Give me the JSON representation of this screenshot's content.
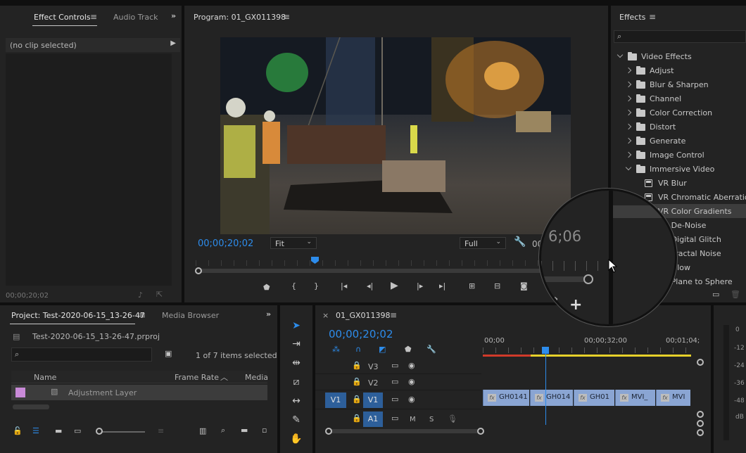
{
  "source_panel": {
    "tabs": [
      "Effect Controls",
      "Audio Track"
    ],
    "no_clip": "(no clip selected)",
    "timecode": "00;00;20;02"
  },
  "program": {
    "title": "Program: 01_GX011398",
    "timecode": "00;00;20;02",
    "fit": "Fit",
    "quality": "Full",
    "duration_partial": "00;00;",
    "magnified_time": "6;06"
  },
  "effects": {
    "title": "Effects",
    "search_placeholder": "",
    "tree": [
      {
        "label": "Video Effects",
        "type": "folder",
        "level": 0,
        "open": true
      },
      {
        "label": "Adjust",
        "type": "folder",
        "level": 1
      },
      {
        "label": "Blur & Sharpen",
        "type": "folder",
        "level": 1
      },
      {
        "label": "Channel",
        "type": "folder",
        "level": 1
      },
      {
        "label": "Color Correction",
        "type": "folder",
        "level": 1
      },
      {
        "label": "Distort",
        "type": "folder",
        "level": 1
      },
      {
        "label": "Generate",
        "type": "folder",
        "level": 1
      },
      {
        "label": "Image Control",
        "type": "folder",
        "level": 1
      },
      {
        "label": "Immersive Video",
        "type": "folder",
        "level": 1,
        "open": true
      },
      {
        "label": "VR Blur",
        "type": "effect",
        "level": 2
      },
      {
        "label": "VR Chromatic Aberratio",
        "type": "effect",
        "level": 2
      },
      {
        "label": "VR Color Gradients",
        "type": "effect",
        "level": 2,
        "selected": true
      },
      {
        "label": "VR De-Noise",
        "type": "effect",
        "level": 2
      },
      {
        "label": "VR Digital Glitch",
        "type": "effect",
        "level": 2
      },
      {
        "label": "VR Fractal Noise",
        "type": "effect",
        "level": 2
      },
      {
        "label": "VR Glow",
        "type": "effect",
        "level": 2
      },
      {
        "label": "VR Plane to Sphere",
        "type": "effect",
        "level": 2
      }
    ],
    "visible_labels": [
      "Video Effects",
      "Adjust",
      "Blur & Sharpen",
      "Channel",
      "Color Correction",
      "Distort",
      "Generate",
      "Image Control",
      "Immersive Video",
      "VR Blur",
      "VR Chromatic Aberratio",
      "VR Color Gradients",
      "De-Noise",
      "igital Glitch",
      "actal Noise",
      "ow",
      "lane to Sphere"
    ]
  },
  "project": {
    "tabs": [
      "Project: Test-2020-06-15_13-26-47",
      "Media Browser"
    ],
    "filename": "Test-2020-06-15_13-26-47.prproj",
    "items_selected": "1 of 7 items selected",
    "columns": [
      "Name",
      "Frame Rate",
      "Media"
    ],
    "items": [
      {
        "name": "Adjustment Layer",
        "color": "#c98ad8"
      }
    ]
  },
  "timeline": {
    "sequence": "01_GX011398",
    "timecode": "00;00;20;02",
    "ruler": [
      "00;00",
      "00;00;32;00",
      "00;01;04;"
    ],
    "tracks": [
      {
        "id": "V3",
        "src": ""
      },
      {
        "id": "V2",
        "src": ""
      },
      {
        "id": "V1",
        "src": "V1"
      },
      {
        "id": "A1",
        "src": ""
      }
    ],
    "audio_buttons": [
      "M",
      "S"
    ],
    "clips": [
      "GH0141",
      "GH014",
      "GH01",
      "MVI_",
      "MVI"
    ]
  },
  "meter": {
    "scale": [
      "0",
      "-12",
      "-24",
      "-36",
      "-48",
      "dB"
    ]
  },
  "colors": {
    "accent": "#2d8ceb",
    "clip": "#8aa5d3",
    "label_purple": "#c98ad8"
  },
  "icons": [
    "menu-icon",
    "chevron-right-icon",
    "expand-icon",
    "wrench-icon",
    "camera-icon",
    "play-icon",
    "step-back-icon",
    "step-forward-icon",
    "add-button-icon",
    "selection-tool-icon",
    "track-select-icon",
    "ripple-edit-icon",
    "razor-icon",
    "slip-icon",
    "pen-icon",
    "hand-icon",
    "lock-icon",
    "eye-icon",
    "film-icon",
    "folder-icon",
    "search-icon",
    "new-bin-icon",
    "trash-icon"
  ]
}
